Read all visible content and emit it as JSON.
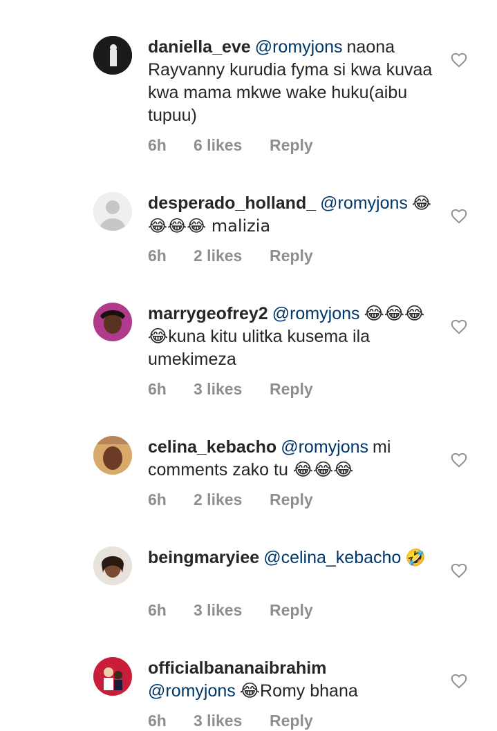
{
  "comments": [
    {
      "username": "daniella_eve",
      "mention": "@romyjons",
      "text": "naona Rayvanny kurudia fyma si kwa kuvaa kwa mama mkwe wake huku(aibu tupuu)",
      "time": "6h",
      "likes": "6 likes",
      "reply": "Reply"
    },
    {
      "username": "desperado_holland_",
      "mention": "@romyjons",
      "text": "😂😂😂😂 malizia",
      "time": "6h",
      "likes": "2 likes",
      "reply": "Reply"
    },
    {
      "username": "marrygeofrey2",
      "mention": "@romyjons",
      "text": "😂😂😂😂kuna kitu ulitka kusema ila umekimeza",
      "time": "6h",
      "likes": "3 likes",
      "reply": "Reply"
    },
    {
      "username": "celina_kebacho",
      "mention": "@romyjons",
      "text": "mi comments zako tu 😂😂😂",
      "time": "6h",
      "likes": "2 likes",
      "reply": "Reply"
    },
    {
      "username": "beingmaryiee",
      "mention": "@celina_kebacho",
      "text": "🤣",
      "time": "6h",
      "likes": "3 likes",
      "reply": "Reply"
    },
    {
      "username": "officialbananaibrahim",
      "mention": "@romyjons",
      "text": "😂Romy bhana",
      "time": "6h",
      "likes": "3 likes",
      "reply": "Reply"
    }
  ],
  "icons": {
    "like": "heart-outline-icon",
    "avatar_placeholder": "default-avatar-icon"
  },
  "colors": {
    "text": "#262626",
    "mention": "#00376b",
    "meta": "#8e8e8e",
    "heart": "#8e8e8e"
  }
}
